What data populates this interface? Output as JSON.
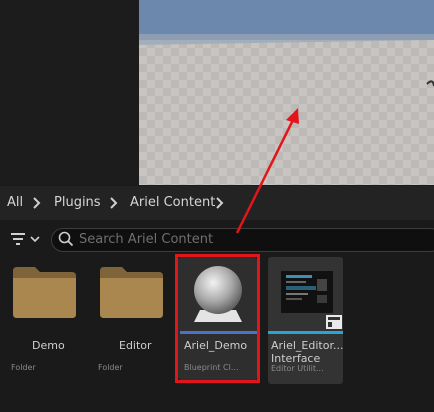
{
  "breadcrumb": {
    "items": [
      "All",
      "Plugins",
      "Ariel Content"
    ]
  },
  "search": {
    "placeholder": "Search Ariel Content"
  },
  "assets": [
    {
      "name": "Demo",
      "type": "Folder"
    },
    {
      "name": "Editor",
      "type": "Folder"
    },
    {
      "name": "Ariel_Demo",
      "type": "Blueprint Cl..."
    },
    {
      "name_line1": "Ariel_Editor...",
      "name_line2": "Interface",
      "type": "Editor Utilit..."
    }
  ],
  "colors": {
    "highlight": "#e2151b",
    "annotation_arrow": "#e2151b",
    "blueprint_stripe": "#4a72c9",
    "editor_utility_stripe": "#26a6d6",
    "folder": "#a9874f"
  },
  "icons": [
    "chevron-right-icon",
    "filter-icon",
    "search-icon",
    "folder-icon",
    "sphere-thumbnail",
    "widget-thumbnail"
  ]
}
